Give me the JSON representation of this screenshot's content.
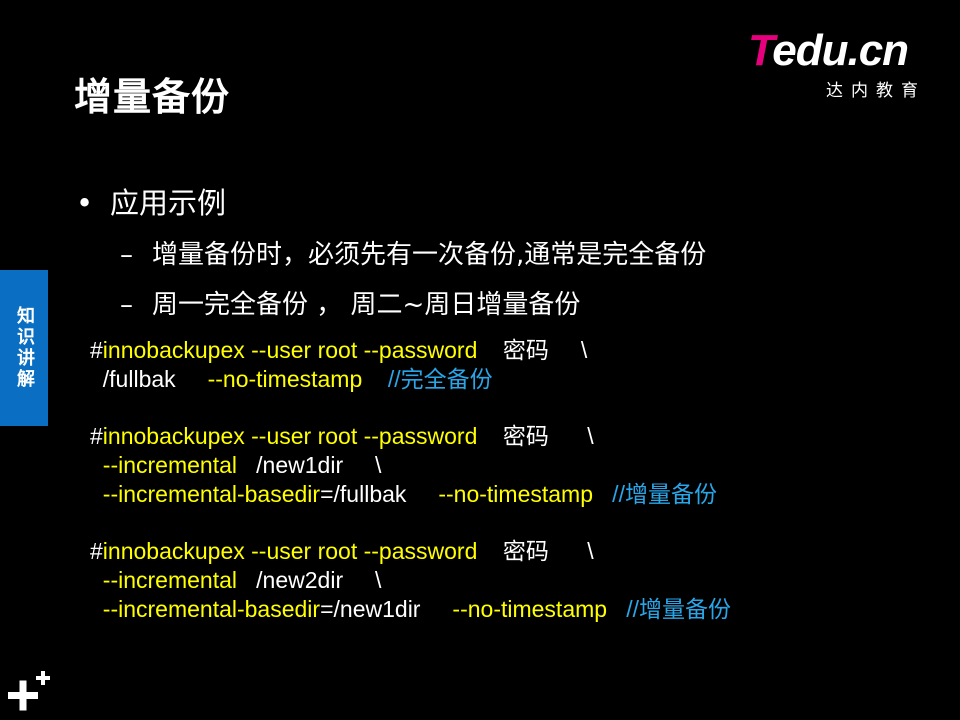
{
  "title": "增量备份",
  "logo": {
    "brand_first": "T",
    "brand_rest": "edu.cn",
    "subtitle": "达内教育",
    "brand_color": "#e6007e"
  },
  "side_tab": {
    "label": "知识讲解",
    "color": "#0a6fc2"
  },
  "bullets": {
    "level1": "应用示例",
    "level2": [
      "增量备份时，必须先有一次备份,通常是完全备份",
      "周一完全备份 ， 周二~周日增量备份"
    ]
  },
  "code_blocks": [
    {
      "lines": [
        [
          {
            "t": "#",
            "c": "w"
          },
          {
            "t": "innobackupex --user root --password",
            "c": "y"
          },
          {
            "t": "    密码     \\",
            "c": "w"
          }
        ],
        [
          {
            "t": "  /fullbak     ",
            "c": "w"
          },
          {
            "t": "--no-timestamp",
            "c": "y"
          },
          {
            "t": "    //完全备份",
            "c": "b"
          }
        ]
      ]
    },
    {
      "lines": [
        [
          {
            "t": "#",
            "c": "w"
          },
          {
            "t": "innobackupex --user root --password",
            "c": "y"
          },
          {
            "t": "    密码      \\",
            "c": "w"
          }
        ],
        [
          {
            "t": "  ",
            "c": "w"
          },
          {
            "t": "--incremental",
            "c": "y"
          },
          {
            "t": "   /new1dir     \\",
            "c": "w"
          }
        ],
        [
          {
            "t": "  ",
            "c": "w"
          },
          {
            "t": "--incremental-basedir",
            "c": "y"
          },
          {
            "t": "=/fullbak     ",
            "c": "w"
          },
          {
            "t": "--no-timestamp",
            "c": "y"
          },
          {
            "t": "   //增量备份",
            "c": "b"
          }
        ]
      ]
    },
    {
      "lines": [
        [
          {
            "t": "#",
            "c": "w"
          },
          {
            "t": "innobackupex --user root --password",
            "c": "y"
          },
          {
            "t": "    密码      \\",
            "c": "w"
          }
        ],
        [
          {
            "t": "  ",
            "c": "w"
          },
          {
            "t": "--incremental",
            "c": "y"
          },
          {
            "t": "   /new2dir     \\",
            "c": "w"
          }
        ],
        [
          {
            "t": "  ",
            "c": "w"
          },
          {
            "t": "--incremental-basedir",
            "c": "y"
          },
          {
            "t": "=/new1dir     ",
            "c": "w"
          },
          {
            "t": "--no-timestamp",
            "c": "y"
          },
          {
            "t": "   //增量备份",
            "c": "b"
          }
        ]
      ]
    }
  ],
  "footer_icon": "plus-icon"
}
